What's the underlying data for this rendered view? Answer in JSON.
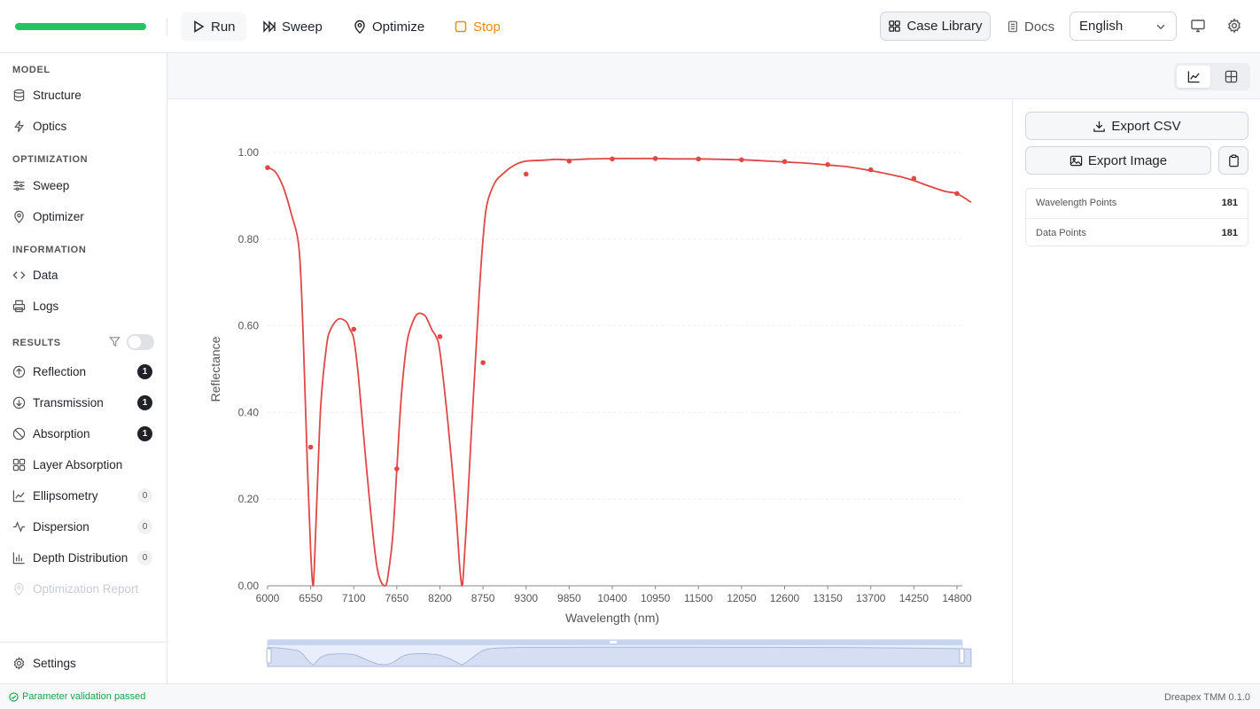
{
  "toolbar": {
    "progress": 1.0,
    "run_label": "Run",
    "sweep_label": "Sweep",
    "optimize_label": "Optimize",
    "stop_label": "Stop",
    "case_library_label": "Case Library",
    "docs_label": "Docs",
    "language": "English"
  },
  "sidebar": {
    "sections": {
      "model": "MODEL",
      "optimization": "OPTIMIZATION",
      "information": "INFORMATION",
      "results": "RESULTS"
    },
    "items": {
      "structure": "Structure",
      "optics": "Optics",
      "sweep": "Sweep",
      "optimizer": "Optimizer",
      "data": "Data",
      "logs": "Logs",
      "reflection": "Reflection",
      "transmission": "Transmission",
      "absorption": "Absorption",
      "layer_absorption": "Layer Absorption",
      "ellipsometry": "Ellipsometry",
      "dispersion": "Dispersion",
      "depth_distribution": "Depth Distribution",
      "optimization_report": "Optimization Report",
      "settings": "Settings"
    },
    "badges": {
      "reflection": "1",
      "transmission": "1",
      "absorption": "1",
      "ellipsometry": "0",
      "dispersion": "0",
      "depth_distribution": "0"
    },
    "results_filter_enabled": false
  },
  "panel": {
    "export_csv_label": "Export CSV",
    "export_image_label": "Export Image",
    "stats": [
      {
        "label": "Wavelength Points",
        "value": "181"
      },
      {
        "label": "Data Points",
        "value": "181"
      }
    ]
  },
  "status": {
    "message": "Parameter validation passed",
    "version": "Dreapex TMM 0.1.0"
  },
  "colors": {
    "accent_green": "#22c55e",
    "stop_orange": "#ea8a1a",
    "series_red": "#e04848"
  },
  "chart_data": {
    "type": "line",
    "title": "",
    "xlabel": "Wavelength (nm)",
    "ylabel": "Reflectance",
    "xlim": [
      6000,
      14800
    ],
    "ylim": [
      0,
      1
    ],
    "x_ticks": [
      "6000",
      "6550",
      "7100",
      "7650",
      "8200",
      "8750",
      "9300",
      "9850",
      "10400",
      "10950",
      "11500",
      "12050",
      "12600",
      "13150",
      "13700",
      "14250",
      "14800"
    ],
    "y_ticks": [
      "0.00",
      "0.20",
      "0.40",
      "0.60",
      "0.80",
      "1.00"
    ],
    "grid": true,
    "legend": "none",
    "series": [
      {
        "x": [
          6000,
          6100,
          6200,
          6300,
          6400,
          6450,
          6500,
          6550,
          6580,
          6600,
          6640,
          6680,
          6750,
          6800,
          6900,
          7000,
          7050,
          7100,
          7150,
          7200,
          7300,
          7400,
          7500,
          7550,
          7600,
          7650,
          7700,
          7750,
          7800,
          7900,
          8000,
          8050,
          8100,
          8150,
          8200,
          8300,
          8400,
          8450,
          8480,
          8500,
          8550,
          8600,
          8650,
          8700,
          8750,
          8800,
          8900,
          9000,
          9100,
          9200,
          9300,
          9500,
          9700,
          9850,
          10100,
          10400,
          10700,
          10950,
          11200,
          11500,
          11800,
          12050,
          12300,
          12600,
          12900,
          13150,
          13400,
          13700,
          13900,
          14100,
          14250,
          14450,
          14650,
          14800,
          14980
        ],
        "y": [
          0.965,
          0.955,
          0.92,
          0.86,
          0.78,
          0.6,
          0.32,
          0.08,
          0.0,
          0.06,
          0.25,
          0.42,
          0.55,
          0.59,
          0.615,
          0.61,
          0.592,
          0.57,
          0.5,
          0.4,
          0.2,
          0.04,
          0.0,
          0.04,
          0.12,
          0.27,
          0.42,
          0.52,
          0.58,
          0.625,
          0.625,
          0.61,
          0.59,
          0.575,
          0.54,
          0.38,
          0.18,
          0.05,
          0.0,
          0.03,
          0.18,
          0.35,
          0.51,
          0.67,
          0.8,
          0.88,
          0.93,
          0.95,
          0.965,
          0.975,
          0.98,
          0.982,
          0.984,
          0.983,
          0.985,
          0.986,
          0.986,
          0.986,
          0.985,
          0.985,
          0.984,
          0.983,
          0.981,
          0.978,
          0.975,
          0.971,
          0.967,
          0.958,
          0.951,
          0.943,
          0.935,
          0.922,
          0.91,
          0.905,
          0.885
        ],
        "markers_x": [
          6000,
          6550,
          7100,
          7650,
          8200,
          8750,
          9300,
          9850,
          10400,
          10950,
          11500,
          12050,
          12600,
          13150,
          13700,
          14250,
          14800
        ],
        "markers_y": [
          0.965,
          0.32,
          0.592,
          0.27,
          0.575,
          0.515,
          0.95,
          0.98,
          0.985,
          0.986,
          0.985,
          0.983,
          0.979,
          0.972,
          0.96,
          0.94,
          0.905
        ]
      }
    ]
  }
}
